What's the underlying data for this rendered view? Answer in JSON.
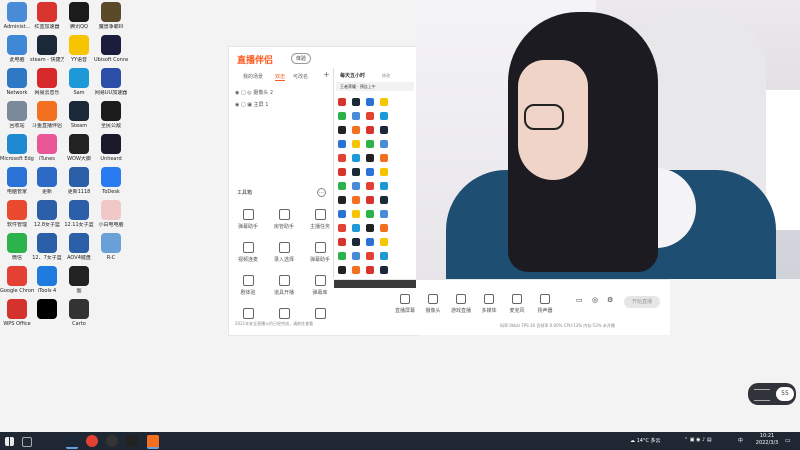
{
  "desktop": {
    "icons": [
      {
        "label": "Administ...",
        "color": "#4a8bd8"
      },
      {
        "label": "此电脑",
        "color": "#3f88d6"
      },
      {
        "label": "Network",
        "color": "#2f78c4"
      },
      {
        "label": "回收站",
        "color": "#7a8a9a"
      },
      {
        "label": "Microsoft Edge",
        "color": "#1d8ad1"
      },
      {
        "label": "电脑管家",
        "color": "#2a72d6"
      },
      {
        "label": "软件管理",
        "color": "#e9492f"
      },
      {
        "label": "微信",
        "color": "#2bb24a"
      },
      {
        "label": "Google Chrome",
        "color": "#e34133"
      },
      {
        "label": "WPS Office",
        "color": "#d4322c"
      },
      {
        "label": "红蓝加速器",
        "color": "#d8332c"
      },
      {
        "label": "steam - 快捷方式",
        "color": "#1b2838"
      },
      {
        "label": "网易云音乐",
        "color": "#d7282a"
      },
      {
        "label": "斗鱼直播伴侣",
        "color": "#f37021"
      },
      {
        "label": "iTunes",
        "color": "#e85796"
      },
      {
        "label": "更新",
        "color": "#2d6ac6"
      },
      {
        "label": "12.8女子篮",
        "color": "#2b5fa8"
      },
      {
        "label": "12、7女子篮",
        "color": "#2b5fa8"
      },
      {
        "label": "iTools 4",
        "color": "#1f7be0"
      },
      {
        "label": "",
        "color": "#000000"
      },
      {
        "label": "腾讯QQ",
        "color": "#1b1b1b"
      },
      {
        "label": "YY语音",
        "color": "#f6c500"
      },
      {
        "label": "Sam",
        "color": "#1c99d6"
      },
      {
        "label": "Steam",
        "color": "#1b2838"
      },
      {
        "label": "WOW大脚",
        "color": "#222222"
      },
      {
        "label": "更新1118",
        "color": "#2b5fa8"
      },
      {
        "label": "12.11女子篮",
        "color": "#2b5fa8"
      },
      {
        "label": "AOV4键盘",
        "color": "#2b5fa8"
      },
      {
        "label": "图",
        "color": "#222222"
      },
      {
        "label": "Carto",
        "color": "#333333"
      },
      {
        "label": "魔兽争霸III",
        "color": "#5a4a2a"
      },
      {
        "label": "Ubisoft Connect",
        "color": "#1c1c3c"
      },
      {
        "label": "网易UU加速器",
        "color": "#2b4fa6"
      },
      {
        "label": "全民公敌",
        "color": "#1c1c1c"
      },
      {
        "label": "Unheard",
        "color": "#1a1a2a"
      },
      {
        "label": "ToDesk",
        "color": "#2a7af0"
      },
      {
        "label": "小白电电脑",
        "color": "#f0c8c8"
      },
      {
        "label": "R-C",
        "color": "#6aa0d8"
      }
    ]
  },
  "app": {
    "logo": "直播伴侣",
    "badge": "体验",
    "tabs": [
      "我的场景",
      "双击",
      "可改名"
    ],
    "add_label": "+",
    "scenes": [
      "摄像头 2",
      "主屏 1"
    ],
    "tools_title": "工具箱",
    "tools": [
      "弹幕助手",
      "房管助手",
      "主播任务",
      "视频连麦",
      "录入选择",
      "弹幕助手",
      "剧体验",
      "道具开播",
      "弹幕库",
      "",
      "",
      ""
    ],
    "status_line": "2021年安全直播公约已经完成，请前往查看"
  },
  "subpanel": {
    "title": "每天五小时",
    "subtitle": "修改",
    "tab_text": "王者荣耀 · 预告上午"
  },
  "toolbar": {
    "items": [
      "直播屏幕",
      "摄像头",
      "游戏直播",
      "多媒体",
      "麦克风",
      "扬声器"
    ],
    "live_button": "开始直播",
    "stats": "码率:0kb/s   FPS:30   丢帧率:0.00%   CPU:13%   内存:53%   未开播"
  },
  "widget": {
    "value": "55"
  },
  "taskbar": {
    "weather": "14°C 多云",
    "time": "10:21",
    "date": "2022/3/3",
    "ime": "中"
  },
  "colors": {
    "accent": "#ff5a1f",
    "taskbar": "#1f2733",
    "jacket": "#1e4e72"
  }
}
